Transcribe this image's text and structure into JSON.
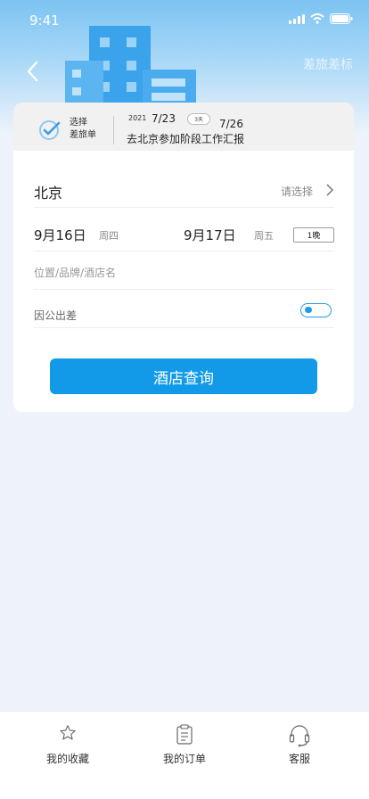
{
  "status_bar": {
    "time": "9:41"
  },
  "header": {
    "policy_label": "差旅差标"
  },
  "trip": {
    "choose_line1": "选择",
    "choose_line2": "差旅单",
    "year": "2021",
    "start": "7/23",
    "days": "3天",
    "end": "7/26",
    "title": "去北京参加阶段工作汇报"
  },
  "form": {
    "city": "北京",
    "city_placeholder": "请选择",
    "checkin_date": "9月16日",
    "checkin_week": "周四",
    "checkout_date": "9月17日",
    "checkout_week": "周五",
    "nights": "1晚",
    "keyword_placeholder": "位置/品牌/酒店名",
    "business_label": "因公出差",
    "business_toggle": true,
    "search_label": "酒店查询"
  },
  "tabs": [
    {
      "label": "我的收藏",
      "icon": "star-icon"
    },
    {
      "label": "我的订单",
      "icon": "clipboard-icon"
    },
    {
      "label": "客服",
      "icon": "headset-icon"
    }
  ],
  "colors": {
    "accent": "#129ae8",
    "header": "#7cc3f2"
  }
}
